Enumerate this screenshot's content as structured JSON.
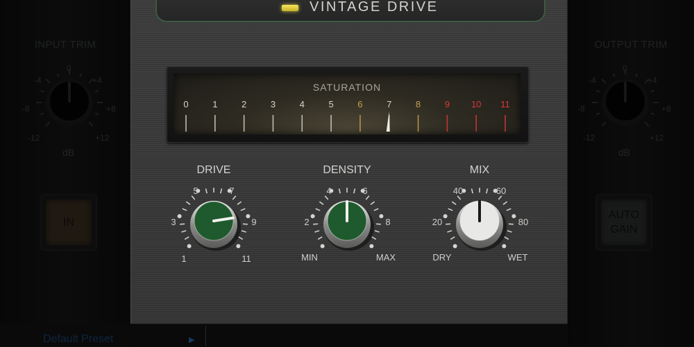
{
  "title": "VINTAGE DRIVE",
  "input_trim": {
    "title": "INPUT TRIM",
    "scale": [
      "0",
      "-4",
      "+4",
      "-8",
      "+8",
      "-12",
      "+12"
    ],
    "unit": "dB"
  },
  "output_trim": {
    "title": "OUTPUT TRIM",
    "scale": [
      "0",
      "-4",
      "+4",
      "-8",
      "+8",
      "-12",
      "+12"
    ],
    "unit": "dB"
  },
  "in_button": {
    "label": "IN"
  },
  "auto_gain_button": {
    "line1": "AUTO",
    "line2": "GAIN"
  },
  "preset": {
    "name": "Default Preset"
  },
  "meter": {
    "title": "SATURATION",
    "ticks": [
      "0",
      "1",
      "2",
      "3",
      "4",
      "5",
      "6",
      "7",
      "8",
      "9",
      "10",
      "11"
    ],
    "needle_value": 7,
    "colors": {
      "normal": "#d9d4c4",
      "warm": "#c8a050",
      "hot": "#d83a38"
    }
  },
  "drive": {
    "title": "DRIVE",
    "labels": [
      "1",
      "3",
      "5",
      "7",
      "9",
      "11"
    ],
    "value": 9,
    "cap_color": "#1f5a2e"
  },
  "density": {
    "title": "DENSITY",
    "labels": [
      "MIN",
      "2",
      "4",
      "6",
      "8",
      "MAX"
    ],
    "value": 5,
    "cap_color": "#1f5a2e"
  },
  "mix": {
    "title": "MIX",
    "labels": [
      "DRY",
      "20",
      "40",
      "60",
      "80",
      "WET"
    ],
    "value": 50,
    "cap_color": "#e8e8e6"
  }
}
